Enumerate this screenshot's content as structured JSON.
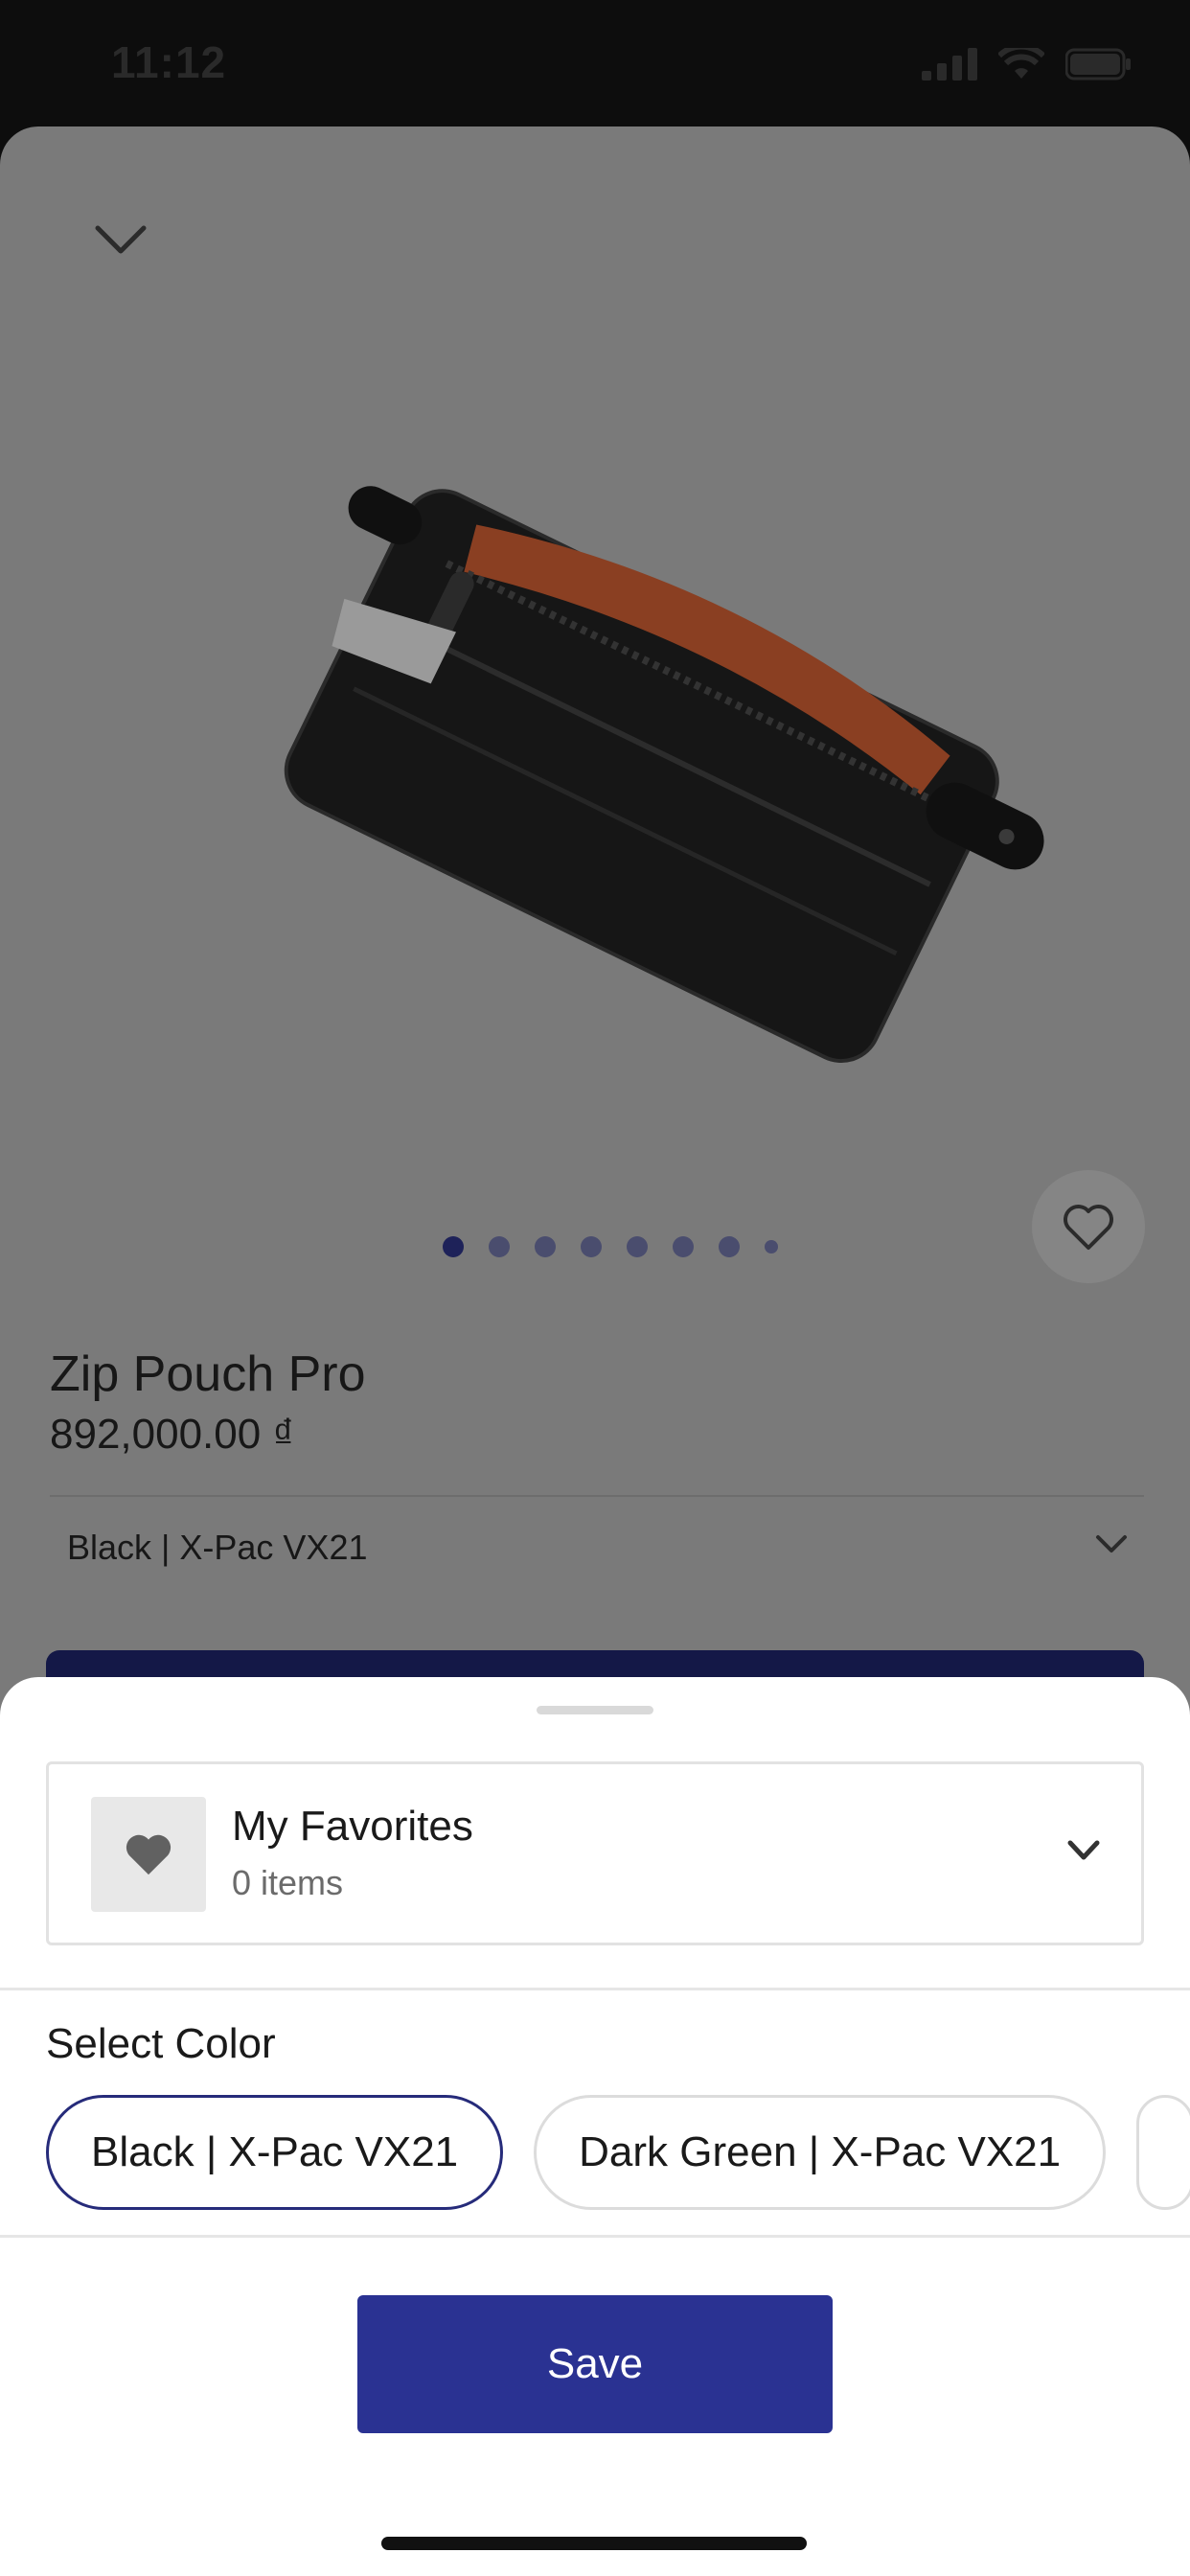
{
  "status_bar": {
    "time": "11:12",
    "icons": [
      "cellular-signal-icon",
      "wifi-icon",
      "battery-icon"
    ]
  },
  "product": {
    "name": "Zip Pouch Pro",
    "price": "892,000.00 ₫",
    "selected_variant": "Black | X-Pac VX21",
    "image_count": 8,
    "active_image_index": 0
  },
  "sheet": {
    "collection": {
      "name": "My Favorites",
      "count_label": "0 items"
    },
    "select_color_label": "Select Color",
    "colors": [
      {
        "label": "Black | X-Pac VX21",
        "selected": true
      },
      {
        "label": "Dark Green | X-Pac VX21",
        "selected": false
      }
    ],
    "save_label": "Save"
  },
  "colors": {
    "primary": "#2a3292",
    "selected_border": "#262b7a",
    "overlay_background": "#7a7a7a"
  }
}
